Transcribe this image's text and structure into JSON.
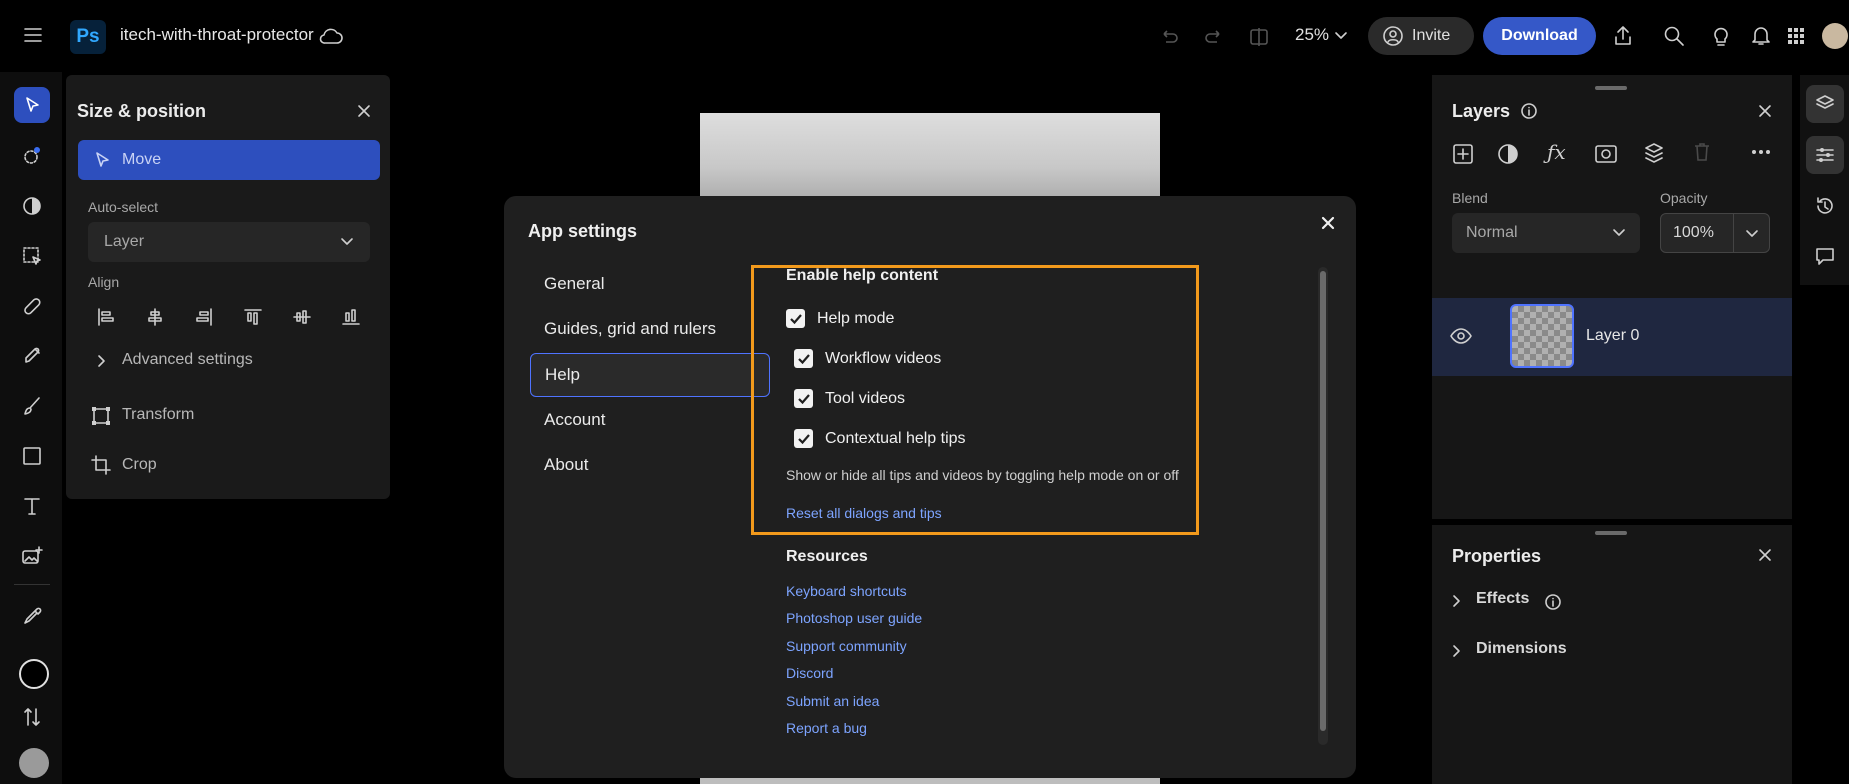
{
  "app": {
    "logo_text": "Ps",
    "doc_title": "itech-with-throat-protector",
    "zoom": "25%",
    "invite_label": "Invite",
    "download_label": "Download"
  },
  "size_panel": {
    "title": "Size & position",
    "move_label": "Move",
    "auto_select_label": "Auto-select",
    "auto_select_value": "Layer",
    "align_label": "Align",
    "advanced_label": "Advanced settings",
    "transform_label": "Transform",
    "crop_label": "Crop"
  },
  "modal": {
    "title": "App settings",
    "nav": [
      "General",
      "Guides, grid and rulers",
      "Help",
      "Account",
      "About"
    ],
    "selected_nav": "Help",
    "help_section_title": "Enable help content",
    "checks": [
      {
        "label": "Help mode",
        "checked": true
      },
      {
        "label": "Workflow videos",
        "checked": true
      },
      {
        "label": "Tool videos",
        "checked": true
      },
      {
        "label": "Contextual help tips",
        "checked": true
      }
    ],
    "description": "Show or hide all tips and videos by toggling help mode on or off",
    "reset_link": "Reset all dialogs and tips",
    "resources_title": "Resources",
    "resources": [
      "Keyboard shortcuts",
      "Photoshop user guide",
      "Support community",
      "Discord",
      "Submit an idea",
      "Report a bug"
    ]
  },
  "layers_panel": {
    "title": "Layers",
    "blend_label": "Blend",
    "blend_value": "Normal",
    "opacity_label": "Opacity",
    "opacity_value": "100%",
    "layer_name": "Layer 0"
  },
  "properties_panel": {
    "title": "Properties",
    "effects_label": "Effects",
    "dimensions_label": "Dimensions"
  },
  "colors": {
    "accent": "#2d4fbe",
    "highlight_box": "#f29a1c",
    "link": "#7da4ff"
  }
}
